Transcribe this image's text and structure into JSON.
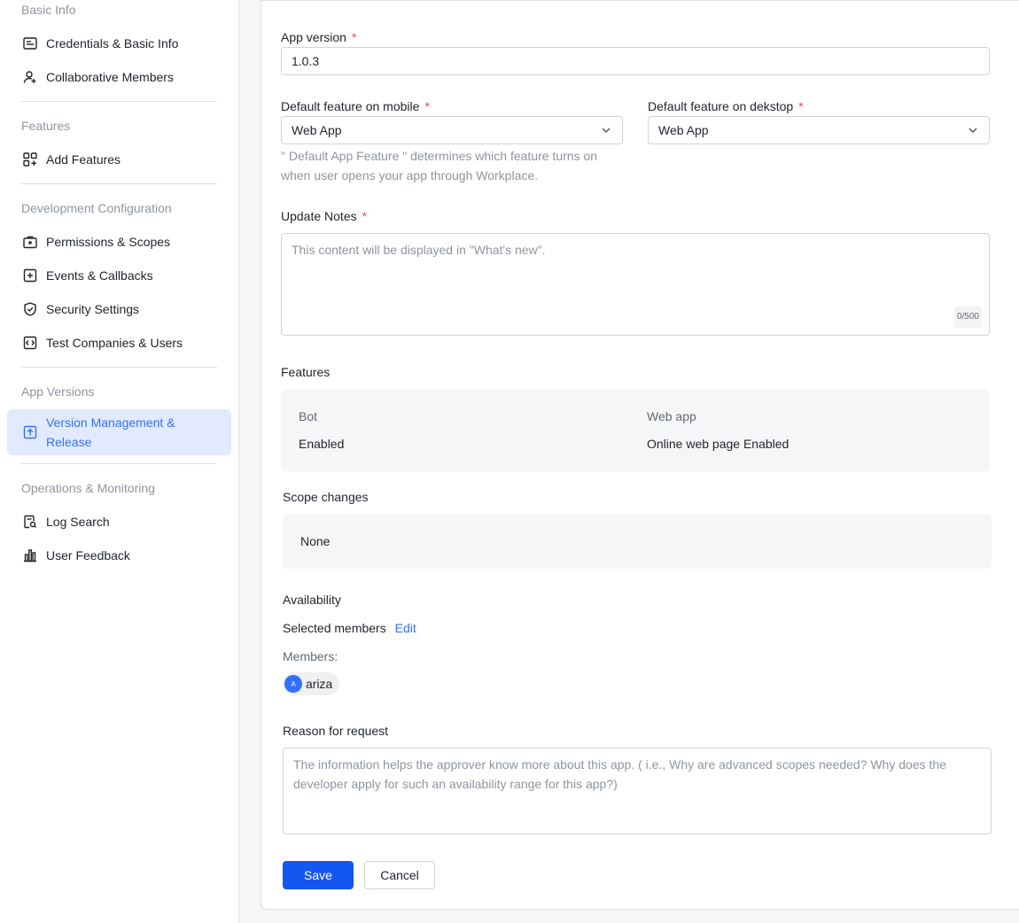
{
  "sidebar": {
    "groups": {
      "basic_info": "Basic Info",
      "features": "Features",
      "dev_config": "Development Configuration",
      "app_versions": "App Versions",
      "operations": "Operations & Monitoring"
    },
    "items": {
      "credentials": "Credentials & Basic Info",
      "collab": "Collaborative Members",
      "add_features": "Add Features",
      "permissions": "Permissions & Scopes",
      "events": "Events & Callbacks",
      "security": "Security Settings",
      "test": "Test Companies & Users",
      "version": "Version Management & Release",
      "log": "Log Search",
      "feedback": "User Feedback"
    }
  },
  "form": {
    "app_version_label": "App version",
    "app_version_value": "1.0.3",
    "mobile_label": "Default feature on mobile",
    "mobile_value": "Web App",
    "desktop_label": "Default feature on dekstop",
    "desktop_value": "Web App",
    "hint": "\" Default App Feature \" determines which feature turns on when user opens your app through Workplace.",
    "notes_label": "Update Notes",
    "notes_placeholder": "This content will be displayed in \"What's new\".",
    "notes_counter": "0/500",
    "required_mark": "*"
  },
  "features": {
    "title": "Features",
    "bot_label": "Bot",
    "bot_value": "Enabled",
    "web_label": "Web app",
    "web_value": "Online web page Enabled"
  },
  "scope": {
    "title": "Scope changes",
    "value": "None"
  },
  "availability": {
    "title": "Availability",
    "selected": "Selected members",
    "edit": "Edit",
    "members_label": "Members:",
    "member_initial": "A",
    "member_name": "ariza"
  },
  "reason": {
    "title": "Reason for request",
    "placeholder": "The information helps the approver know more about this app. ( i.e., Why are advanced scopes needed? Why does the developer apply for such an availability range for this app?)"
  },
  "actions": {
    "save": "Save",
    "cancel": "Cancel"
  }
}
